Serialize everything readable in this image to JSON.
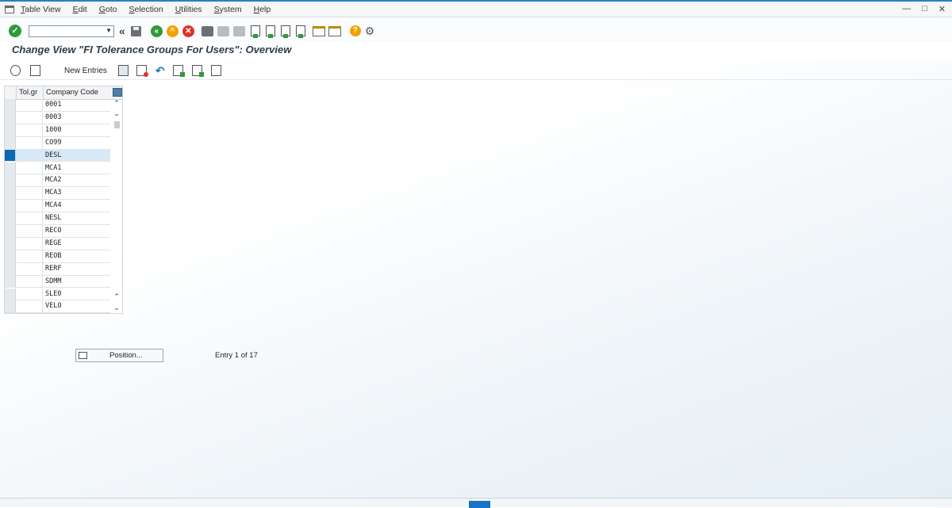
{
  "menubar": {
    "items": [
      "Table View",
      "Edit",
      "Goto",
      "Selection",
      "Utilities",
      "System",
      "Help"
    ]
  },
  "systoolbar": {
    "command_value": ""
  },
  "page_title": "Change View \"FI Tolerance Groups For Users\": Overview",
  "apptoolbar": {
    "new_entries_label": "New Entries"
  },
  "table": {
    "columns": [
      "Tol.gr",
      "Company Code"
    ],
    "rows": [
      {
        "tol": "",
        "company_code": "0001"
      },
      {
        "tol": "",
        "company_code": "0003"
      },
      {
        "tol": "",
        "company_code": "1000"
      },
      {
        "tol": "",
        "company_code": "CO99"
      },
      {
        "tol": "",
        "company_code": "DESL"
      },
      {
        "tol": "",
        "company_code": "MCA1"
      },
      {
        "tol": "",
        "company_code": "MCA2"
      },
      {
        "tol": "",
        "company_code": "MCA3"
      },
      {
        "tol": "",
        "company_code": "MCA4"
      },
      {
        "tol": "",
        "company_code": "NESL"
      },
      {
        "tol": "",
        "company_code": "RECO"
      },
      {
        "tol": "",
        "company_code": "REGE"
      },
      {
        "tol": "",
        "company_code": "REOB"
      },
      {
        "tol": "",
        "company_code": "RERF"
      },
      {
        "tol": "",
        "company_code": "SDMM"
      },
      {
        "tol": "",
        "company_code": "SLE0"
      },
      {
        "tol": "",
        "company_code": "VELO"
      }
    ],
    "selected_row": 4
  },
  "position_button_label": "Position...",
  "entry_info": "Entry 1 of 17",
  "colors": {
    "accent": "#0a6ab6",
    "selected_row": "#d7e9f7",
    "ok_green": "#2e9a3b",
    "cancel_red": "#d9342b",
    "exit_orange": "#f0a300"
  },
  "icons": [
    "check-icon",
    "back-icon",
    "exit-icon",
    "cancel-icon",
    "print-icon",
    "find-icon",
    "help-icon",
    "settings-icon",
    "display-icon",
    "copy-icon",
    "delete-icon",
    "undo-icon"
  ]
}
